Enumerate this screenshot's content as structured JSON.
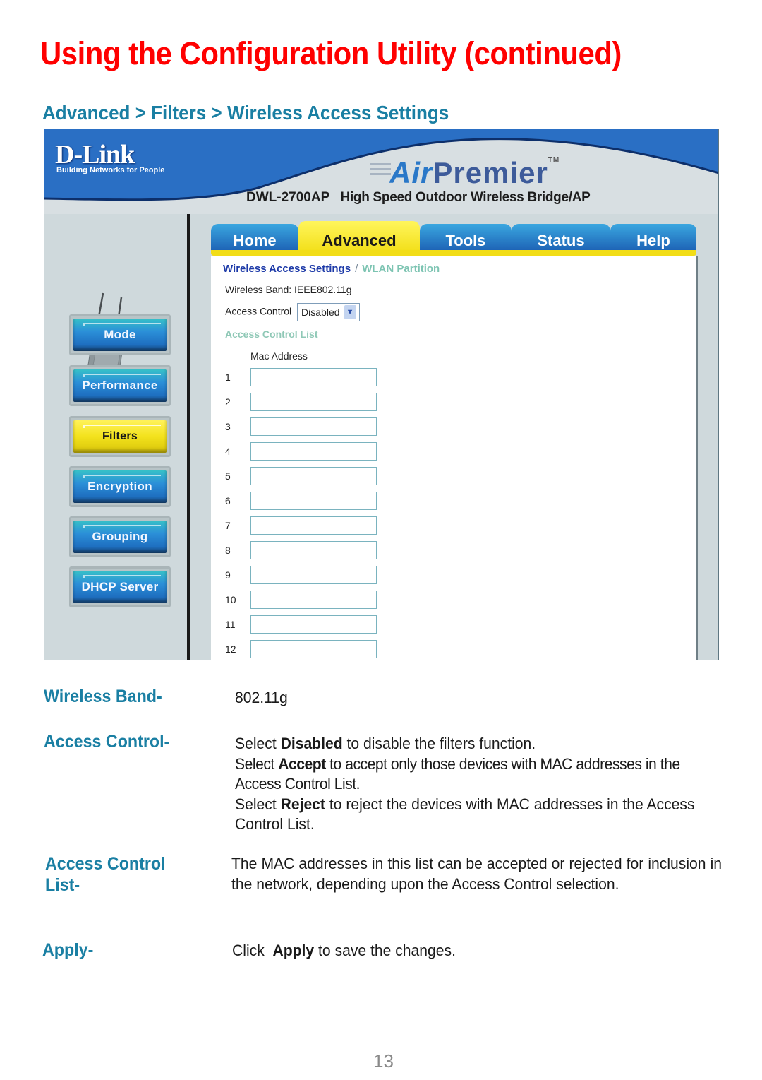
{
  "page": {
    "title": "Using the Configuration Utility (continued)",
    "section_heading": "Advanced > Filters > Wireless Access Settings",
    "page_number": "13"
  },
  "screenshot": {
    "brand": {
      "logo": "D-Link",
      "tagline": "Building Networks for People",
      "product_line_a": "Air",
      "product_line_b": "Premier",
      "trademark": "TM",
      "model": "DWL-2700AP",
      "model_description": "High Speed Outdoor Wireless Bridge/AP"
    },
    "tabs": [
      {
        "label": "Home",
        "active": false
      },
      {
        "label": "Advanced",
        "active": true
      },
      {
        "label": "Tools",
        "active": false
      },
      {
        "label": "Status",
        "active": false
      },
      {
        "label": "Help",
        "active": false
      }
    ],
    "sidebar": [
      {
        "label": "Mode",
        "active": false
      },
      {
        "label": "Performance",
        "active": false
      },
      {
        "label": "Filters",
        "active": true
      },
      {
        "label": "Encryption",
        "active": false
      },
      {
        "label": "Grouping",
        "active": false
      },
      {
        "label": "DHCP Server",
        "active": false
      }
    ],
    "subnav": {
      "current": "Wireless Access Settings",
      "separator": "/",
      "link": "WLAN Partition"
    },
    "wireless_band": {
      "label": "Wireless Band:",
      "value": "IEEE802.11g"
    },
    "access_control": {
      "label": "Access Control",
      "selected": "Disabled"
    },
    "acl": {
      "title": "Access Control List",
      "column_header": "Mac Address",
      "rows": [
        {
          "num": "1",
          "value": ""
        },
        {
          "num": "2",
          "value": ""
        },
        {
          "num": "3",
          "value": ""
        },
        {
          "num": "4",
          "value": ""
        },
        {
          "num": "5",
          "value": ""
        },
        {
          "num": "6",
          "value": ""
        },
        {
          "num": "7",
          "value": ""
        },
        {
          "num": "8",
          "value": ""
        },
        {
          "num": "9",
          "value": ""
        },
        {
          "num": "10",
          "value": ""
        },
        {
          "num": "11",
          "value": ""
        },
        {
          "num": "12",
          "value": ""
        }
      ]
    }
  },
  "descriptions": {
    "wireless_band": {
      "label": "Wireless Band-",
      "text": "802.11g"
    },
    "access_control": {
      "label": "Access Control-",
      "line1_pre": "Select ",
      "line1_bold": "Disabled",
      "line1_post": " to disable the filters function.",
      "line2_pre": "Select ",
      "line2_bold": "Accept",
      "line2_post": " to accept only those devices with MAC addresses in the Access Control List.",
      "line3_pre": "Select ",
      "line3_bold": "Reject",
      "line3_post": " to reject the devices with MAC addresses in the Access Control List."
    },
    "acl": {
      "label_line1": "Access Control",
      "label_line2": "List-",
      "text": "The MAC addresses in this list can be accepted or rejected for inclusion in the network, depending upon the Access Control selection."
    },
    "apply": {
      "label": "Apply-",
      "pre": "Click  ",
      "bold": "Apply",
      "post": " to save the changes."
    }
  }
}
